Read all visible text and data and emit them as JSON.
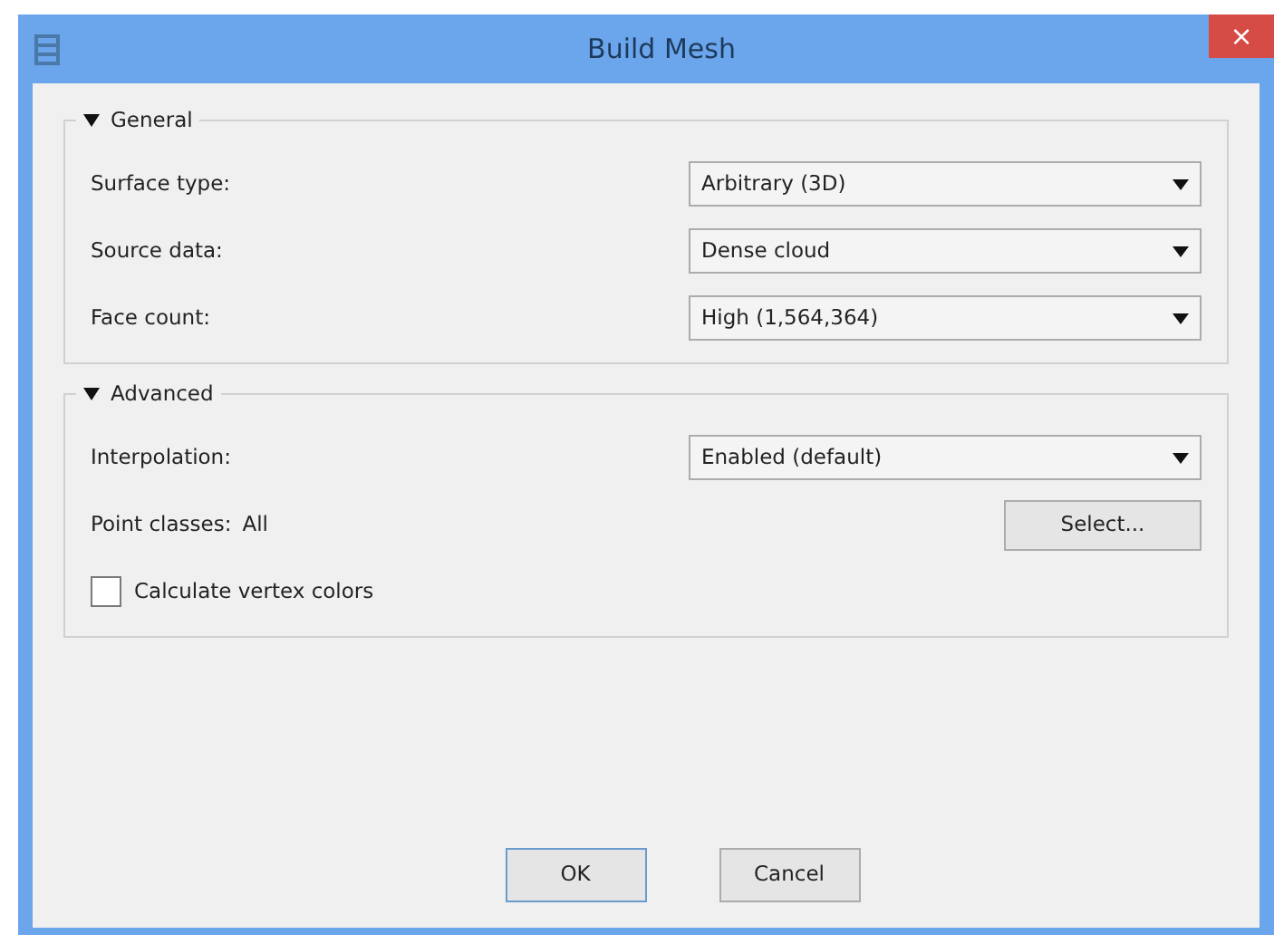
{
  "window": {
    "title": "Build Mesh",
    "close": "×"
  },
  "groups": [
    {
      "title": "General",
      "expanded": true,
      "rows": [
        {
          "kind": "dropdown",
          "label": "Surface type:",
          "value": "Arbitrary (3D)"
        },
        {
          "kind": "dropdown",
          "label": "Source data:",
          "value": "Dense cloud"
        },
        {
          "kind": "dropdown",
          "label": "Face count:",
          "value": "High (1,564,364)"
        }
      ]
    },
    {
      "title": "Advanced",
      "expanded": true,
      "rows": [
        {
          "kind": "dropdown",
          "label": "Interpolation:",
          "value": "Enabled (default)"
        },
        {
          "kind": "selector",
          "label": "Point classes:",
          "value": "All",
          "button": "Select..."
        },
        {
          "kind": "checkbox",
          "label": "Calculate vertex colors",
          "checked": false
        }
      ]
    }
  ],
  "buttons": [
    "OK",
    "Cancel"
  ]
}
